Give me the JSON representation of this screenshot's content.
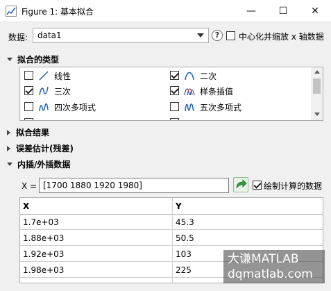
{
  "window": {
    "title": "Figure 1: 基本拟合",
    "minimize": "—",
    "maximize": "☐",
    "close": "✕"
  },
  "data_row": {
    "label": "数据:",
    "selected": "data1",
    "center_scale_label": "中心化并缩放 x 轴数据",
    "center_scale_checked": false
  },
  "sections": {
    "fit_types": "拟合的类型",
    "fit_results": "拟合结果",
    "error_estimate": "误差估计(残差)",
    "interp": "内插/外插数据"
  },
  "fit_types": [
    {
      "label": "线性",
      "checked": false,
      "icon": "linear-fit-icon"
    },
    {
      "label": "二次",
      "checked": true,
      "icon": "quadratic-fit-icon"
    },
    {
      "label": "三次",
      "checked": true,
      "icon": "cubic-fit-icon"
    },
    {
      "label": "样条插值",
      "checked": true,
      "icon": "spline-fit-icon"
    },
    {
      "label": "四次多项式",
      "checked": false,
      "icon": "quartic-fit-icon"
    },
    {
      "label": "五次多项式",
      "checked": false,
      "icon": "quintic-fit-icon"
    }
  ],
  "interp": {
    "x_label": "X =",
    "x_value": "[1700 1880 1920 1980]",
    "plot_label": "绘制计算的数据",
    "plot_checked": true
  },
  "table": {
    "headers": [
      "X",
      "Y"
    ],
    "rows": [
      [
        "1.7e+03",
        "45.3"
      ],
      [
        "1.88e+03",
        "50.5"
      ],
      [
        "1.92e+03",
        "103"
      ],
      [
        "1.98e+03",
        "225"
      ]
    ]
  },
  "watermark": {
    "line1": "大谦MATLAB",
    "line2": "dqmatlab.com"
  },
  "colors": {
    "accent_blue": "#1f5fbf",
    "go_green": "#2e9e3e"
  }
}
